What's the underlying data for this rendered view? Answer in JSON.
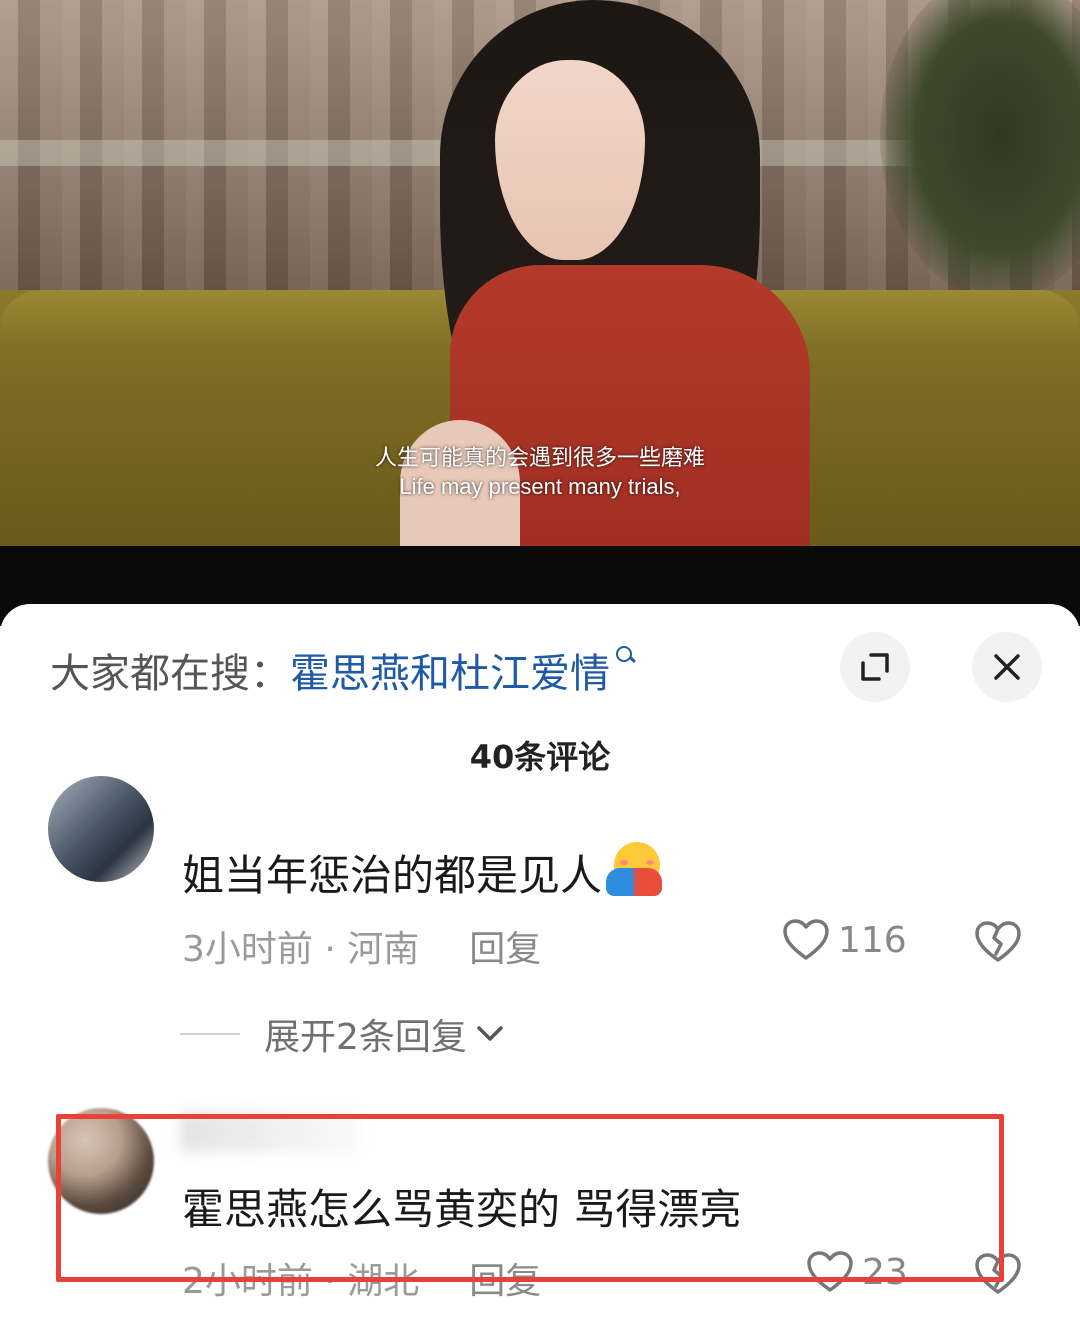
{
  "video": {
    "subtitle_cn": "人生可能真的会遇到很多一些磨难",
    "subtitle_en": "Life may present many trials,"
  },
  "search": {
    "prefix": "大家都在搜：",
    "query": "霍思燕和杜江爱情"
  },
  "comments_header": {
    "count_label": "40条评论"
  },
  "comments": [
    {
      "text": "姐当年惩治的都是见人",
      "emoji": "hugging-face-emoji",
      "time_location": "3小时前 · 河南",
      "reply_label": "回复",
      "likes": "116",
      "expand_replies": "展开2条回复"
    },
    {
      "text": "霍思燕怎么骂黄奕的 骂得漂亮",
      "time_location": "2小时前 · 湖北",
      "reply_label": "回复",
      "likes": "23",
      "highlighted": true
    }
  ],
  "colors": {
    "search_query": "#1f5aa6",
    "highlight_border": "#e8413a",
    "meta_text": "#9a9a9a"
  }
}
